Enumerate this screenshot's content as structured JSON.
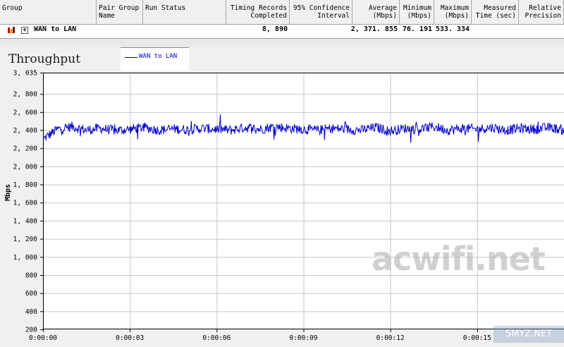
{
  "table": {
    "columns": [
      {
        "label": "Group"
      },
      {
        "label": "Pair Group\nName"
      },
      {
        "label": "Run Status"
      },
      {
        "label": "Timing Records\nCompleted"
      },
      {
        "label": "95% Confidence\nInterval"
      },
      {
        "label": "Average\n(Mbps)"
      },
      {
        "label": "Minimum\n(Mbps)"
      },
      {
        "label": "Maximum\n(Mbps)"
      },
      {
        "label": "Measured\nTime (sec)"
      },
      {
        "label": "Relative\nPrecision"
      }
    ],
    "row": {
      "group": "WAN to LAN",
      "pair_group_name": "",
      "run_status": "",
      "timing_records": "8, 890",
      "confidence_interval": "",
      "average": "2, 371. 855",
      "minimum": "76. 191",
      "maximum": "533. 334",
      "measured_time": "",
      "relative_precision": ""
    }
  },
  "watermarks": [
    "acwifi.net",
    "SMYZ.NET"
  ],
  "chart_data": {
    "type": "line",
    "title": "Throughput",
    "ylabel": "Mbps",
    "xlabel": "",
    "ylim": [
      200,
      3035
    ],
    "xlim": [
      0,
      18
    ],
    "y_ticks": [
      "3, 035",
      "2, 800",
      "2, 600",
      "2, 400",
      "2, 200",
      "2, 000",
      "1, 800",
      "1, 600",
      "1, 400",
      "1, 200",
      "1, 000",
      "800",
      "600",
      "400",
      "200"
    ],
    "y_tick_values": [
      3035,
      2800,
      2600,
      2400,
      2200,
      2000,
      1800,
      1600,
      1400,
      1200,
      1000,
      800,
      600,
      400,
      200
    ],
    "x_ticks": [
      "0:00:00",
      "0:00:03",
      "0:00:06",
      "0:00:09",
      "0:00:12",
      "0:00:15"
    ],
    "x_tick_values": [
      0,
      3,
      6,
      9,
      12,
      15
    ],
    "grid": true,
    "legend_position": "top",
    "series": [
      {
        "name": "WAN to LAN",
        "color": "#0000cc",
        "x": [
          0,
          0.5,
          1,
          1.5,
          2,
          2.5,
          3,
          3.5,
          4,
          4.5,
          5,
          5.5,
          6,
          6.5,
          7,
          7.5,
          8,
          8.5,
          9,
          9.5,
          10,
          10.5,
          11,
          11.5,
          12,
          12.5,
          13,
          13.5,
          14,
          14.5,
          15,
          15.5,
          16,
          16.5,
          17,
          17.5,
          18
        ],
        "y": [
          2300,
          2410,
          2440,
          2400,
          2420,
          2395,
          2410,
          2430,
          2400,
          2415,
          2405,
          2420,
          2410,
          2400,
          2430,
          2410,
          2440,
          2420,
          2410,
          2400,
          2420,
          2410,
          2400,
          2430,
          2390,
          2420,
          2410,
          2440,
          2400,
          2420,
          2410,
          2430,
          2400,
          2420,
          2410,
          2430,
          2400
        ]
      }
    ]
  }
}
